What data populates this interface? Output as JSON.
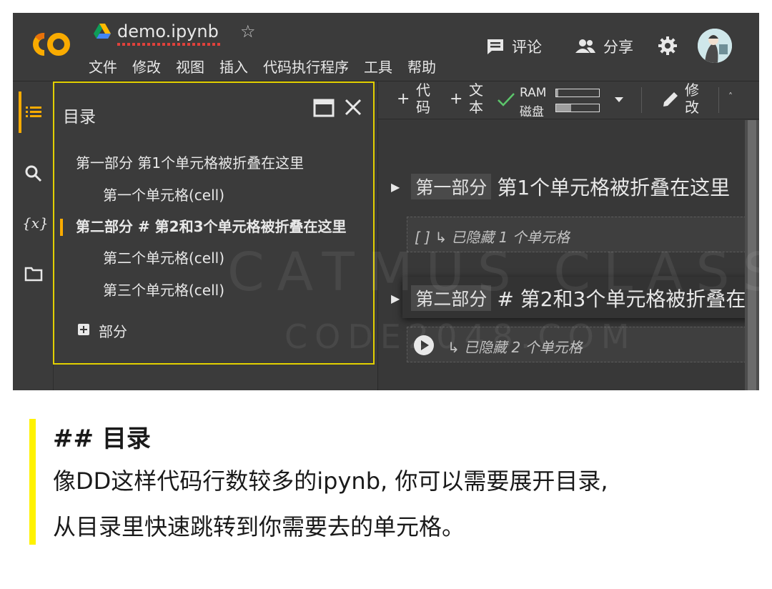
{
  "header": {
    "logo": "CO",
    "file_name": "demo.ipynb",
    "menu": [
      "文件",
      "修改",
      "视图",
      "插入",
      "代码执行程序",
      "工具",
      "帮助"
    ],
    "comment_label": "评论",
    "share_label": "分享"
  },
  "toc": {
    "title": "目录",
    "items": [
      "第一部分 第1个单元格被折叠在这里",
      "第一个单元格(cell)",
      "第二部分 # 第2和3个单元格被折叠在这里",
      "第二个单元格(cell)",
      "第三个单元格(cell)"
    ],
    "add_section_label": "部分"
  },
  "toolbar": {
    "add_code_label": "代码",
    "add_text_label": "文本",
    "ram_label": "RAM",
    "disk_label": "磁盘",
    "ram_usage": 0.05,
    "disk_usage": 0.35,
    "edit_label": "修改"
  },
  "notebook": {
    "sections": [
      {
        "prefix": "第一部分",
        "title": "第1个单元格被折叠在这里",
        "hidden": "[ ]  ↳ 已隐藏 1 个单元格"
      },
      {
        "prefix": "第二部分",
        "title": "# 第2和3个单元格被折叠在",
        "hidden": "↳ 已隐藏 2 个单元格"
      }
    ]
  },
  "watermark": {
    "line1": "CATMUS CLASS",
    "line2": "CODE2048.COM"
  },
  "note": {
    "heading": "## 目录",
    "line1": "像DD这样代码行数较多的ipynb, 你可以需要展开目录,",
    "line2": "从目录里快速跳转到你需要去的单元格。"
  }
}
